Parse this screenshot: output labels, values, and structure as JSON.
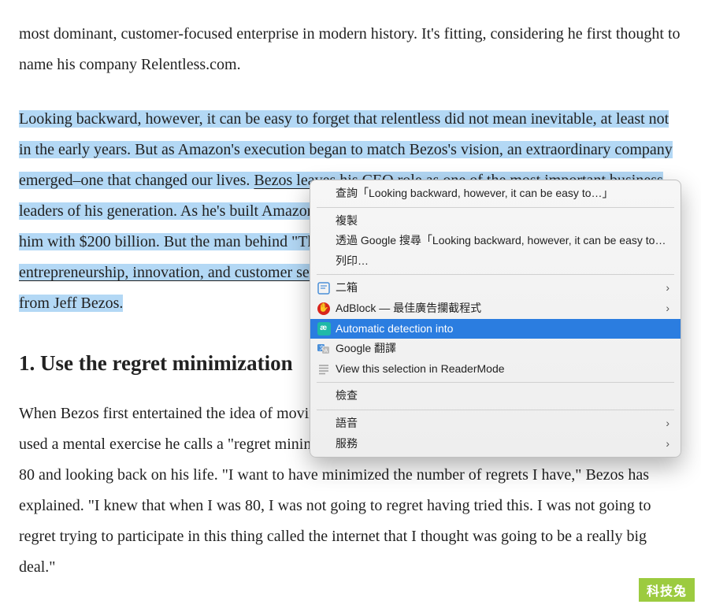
{
  "article": {
    "p1_pre": "most dominant, customer-focused enterprise in modern history. It's fitting, considering he first thought to name his company Relentless.com.",
    "p2_hl_a": "Looking backward, however, it can be easy to forget that relentless did not mean inevitable, at least not in the early years. But as Amazon's execution began to match Bezos's vision, an extraordinary company emerged–one that changed our lives. ",
    "p2_link": "Bezos leaves his CEO role",
    "p2_hl_b": " as one of the most important business leaders of his generation. As he's built Amazon from zero to nearly $1.7 trillion, the market has rewarded him with $200 billion. But the man behind \"The Everything Store\" gave ",
    "p2_hl_link2": "the world a master class in entrepreneurship, innovation, and customer service",
    "p2_hl_c": ". Here are five lessons every entrepreneur can learn from Jeff Bezos.",
    "heading": "1. Use the regret minimization",
    "p3": "When Bezos first entertained the idea of moving across the country to start an internet bookstore, he used a mental exercise he calls a \"regret minimization framework.\" The idea was to think about turning 80 and looking back on his life. \"I want to have minimized the number of regrets I have,\" Bezos has explained. \"I knew that when I was 80, I was not going to regret having tried this. I was not going to regret trying to participate in this thing called the internet that I thought was going to be a really big deal.\""
  },
  "menu": {
    "lookup": "查詢「Looking backward, however, it can be easy to…」",
    "copy": "複製",
    "googleSearch": "透過 Google 搜尋「Looking backward, however, it can be easy to…」",
    "print": "列印…",
    "erxiang": "二箱",
    "adblock": "AdBlock — 最佳廣告攔截程式",
    "autodetect": "Automatic detection into",
    "gtranslate": "Google 翻譯",
    "reader": "View this selection in ReaderMode",
    "inspect": "檢查",
    "speech": "語音",
    "services": "服務"
  },
  "badge": "科技兔"
}
